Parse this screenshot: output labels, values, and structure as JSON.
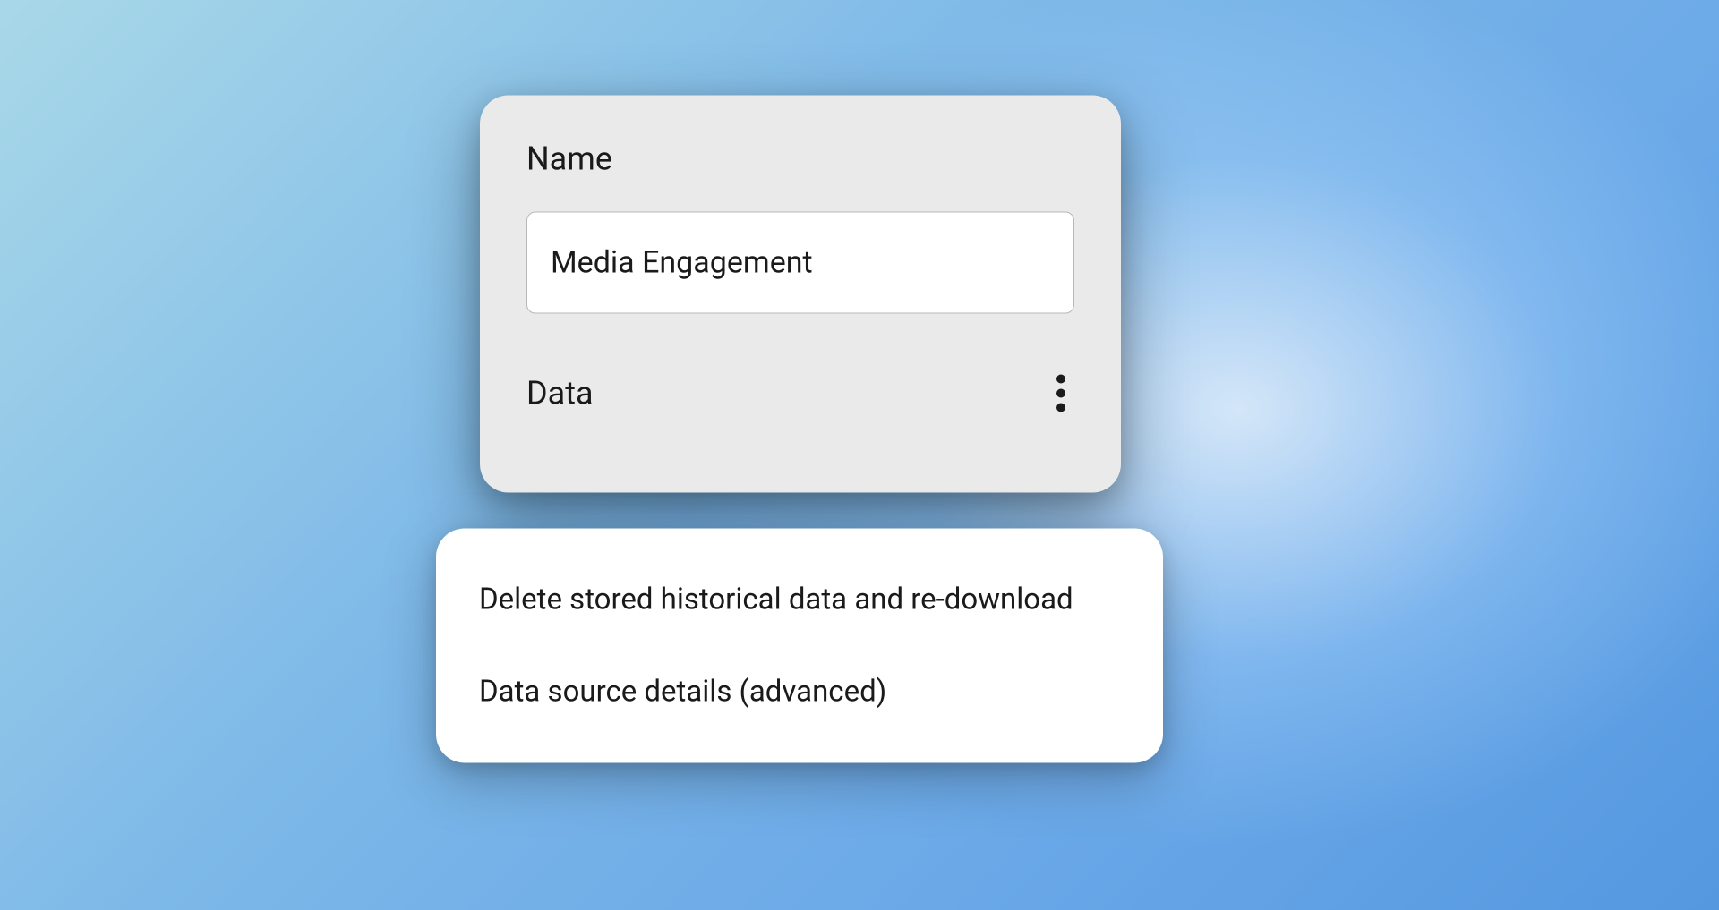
{
  "card": {
    "name_label": "Name",
    "name_value": "Media Engagement",
    "data_label": "Data"
  },
  "menu": {
    "items": [
      {
        "label": "Delete stored historical data and re-download"
      },
      {
        "label": "Data source details (advanced)"
      }
    ]
  }
}
